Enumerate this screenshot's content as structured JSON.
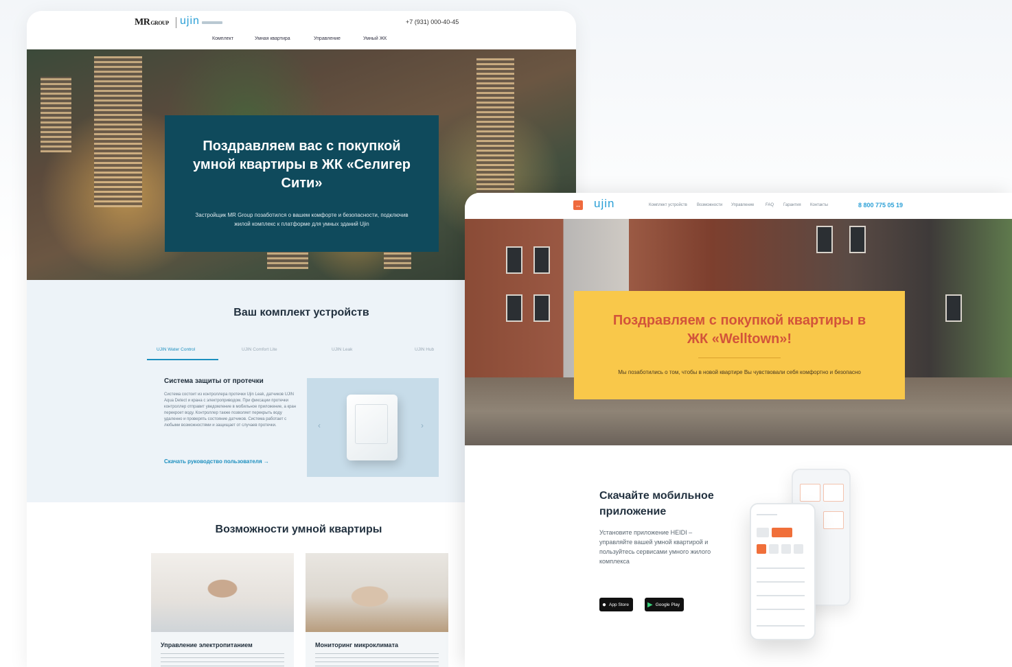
{
  "pageA": {
    "header": {
      "logo_mr": "MR",
      "logo_group": "GROUP",
      "logo_ujin": "ujin",
      "phone": "+7 (931) 000-40-45",
      "nav": [
        "Комплект",
        "Умная квартира",
        "Управление",
        "Умный ЖК"
      ]
    },
    "hero": {
      "title": "Поздравляем вас с покупкой умной квартиры в ЖК «Селигер Сити»",
      "subtitle": "Застройщик MR Group позаботился о вашем комфорте и безопасности, подключив жилой комплекс к платформе для умных зданий Ujin"
    },
    "devices": {
      "title": "Ваш комплект устройств",
      "tabs": [
        "UJIN Water Control",
        "UJIN Comfort Lite",
        "UJIN Leak",
        "UJIN Hub"
      ],
      "active_tab": 0,
      "item_title": "Система защиты от протечки",
      "item_description": "Система состоит из контроллера протечки Ujin Leak, датчиков UJIN Aqua Detect и крана с электроприводом. При фиксации протечки контроллер отправит уведомление в мобильное приложение, а кран перекроет воду. Контроллер также позволяет перекрыть воду удаленно и проверять состояние датчиков. Система работает с любыми возможностями и защищает от случаев протечки.",
      "download_link": "Скачать руководство пользователя →"
    },
    "features": {
      "title": "Возможности умной квартиры",
      "cards": [
        {
          "label": "Управление электропитанием"
        },
        {
          "label": "Мониторинг микроклимата"
        }
      ]
    }
  },
  "pageB": {
    "header": {
      "logo_ujin": "ujin",
      "nav": [
        "Комплект устройств",
        "Возможности",
        "Управление",
        "FAQ",
        "Гарантия",
        "Контакты"
      ],
      "phone": "8 800 775 05 19"
    },
    "hero": {
      "title": "Поздравляем с покупкой квартиры в ЖК «Welltown»!",
      "subtitle": "Мы позаботились о том, чтобы в новой квартире Вы чувствовали себя комфортно и безопасно"
    },
    "app": {
      "title": "Скачайте мобильное приложение",
      "description": "Установите приложение HEIDI – управляйте вашей умной квартирой и пользуйтесь сервисами умного жилого комплекса",
      "app_store": "App Store",
      "google_play": "Google Play"
    }
  },
  "colors": {
    "teal_card": "#0f4a5c",
    "yellow_card": "#f9c84a",
    "accent_blue": "#2a9fd6",
    "accent_orange": "#ef6a3d",
    "title_red": "#d2543a"
  }
}
